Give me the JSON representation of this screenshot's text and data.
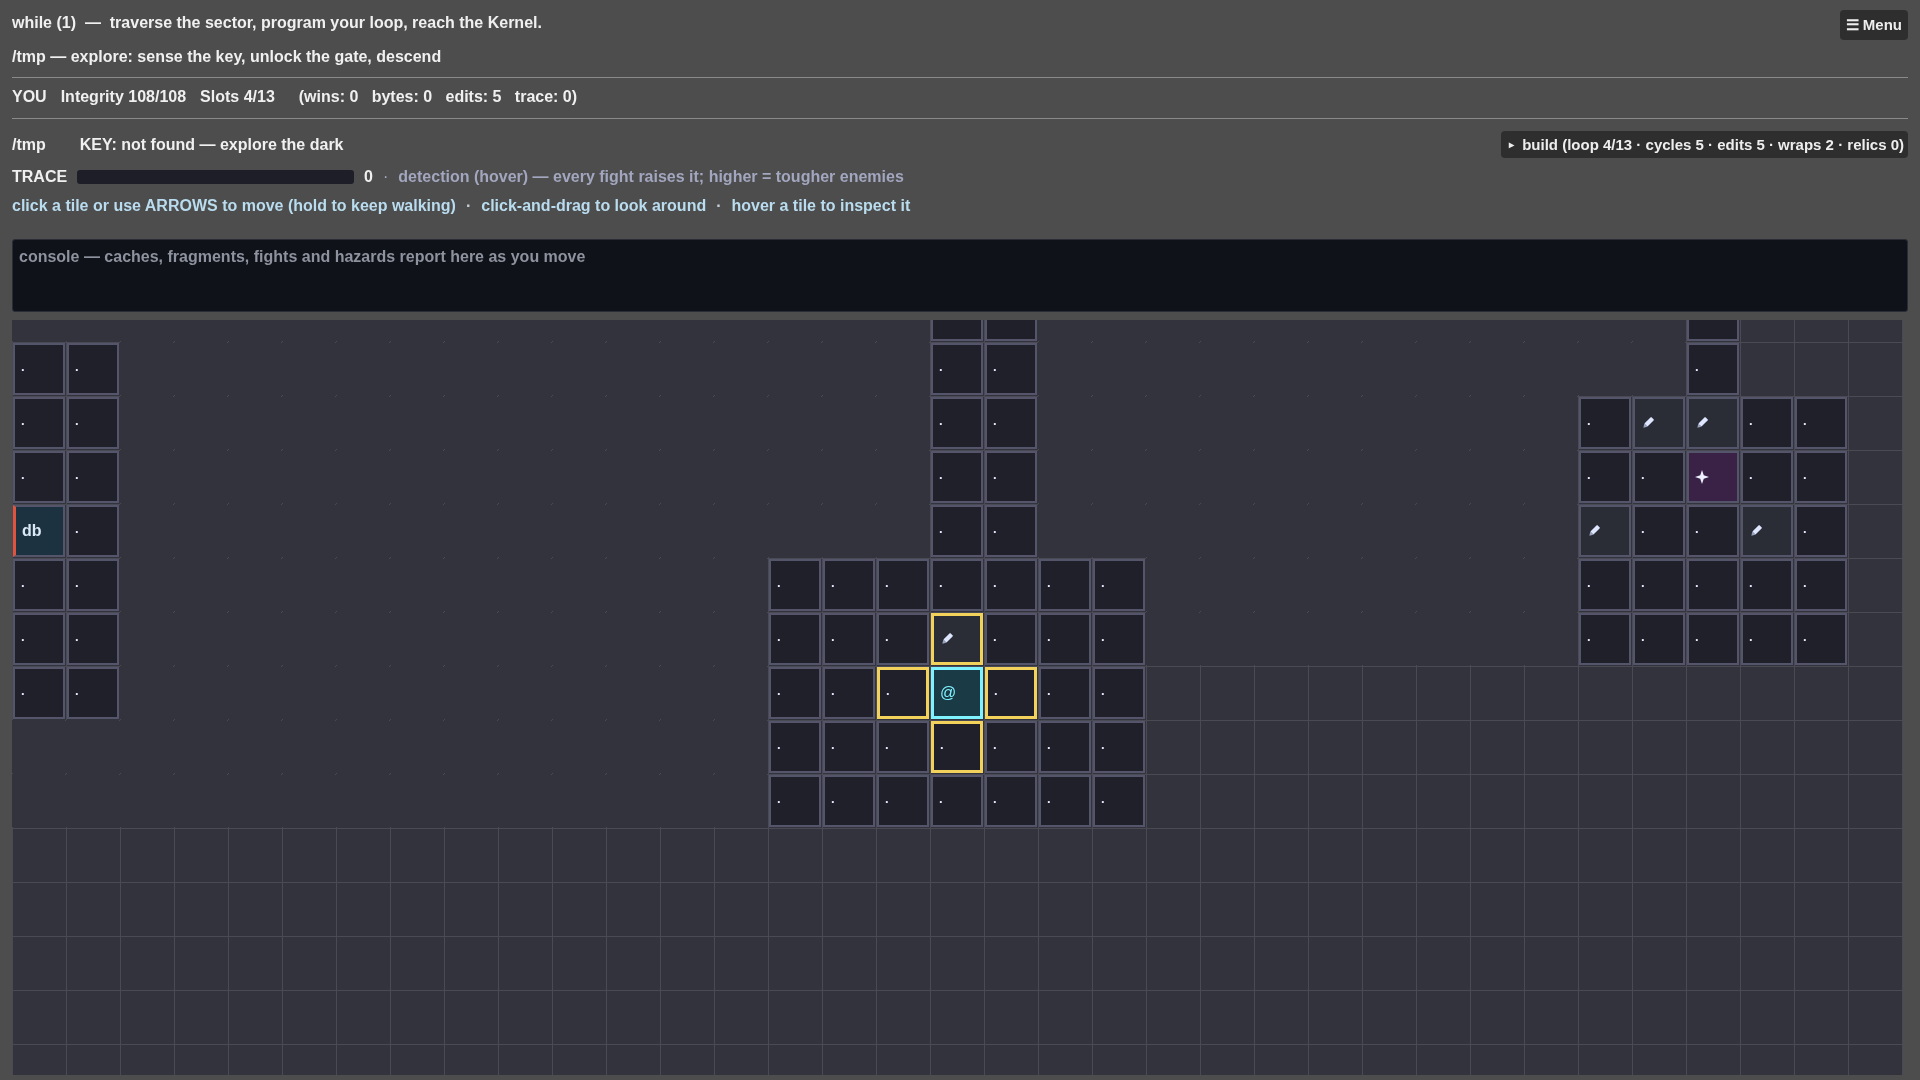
{
  "title": "while (1)  —  traverse the sector, program your loop, reach the Kernel.",
  "menu_button": "☰ Menu",
  "subtitle": "/tmp — explore: sense the key, unlock the gate, descend",
  "status": {
    "you": "YOU",
    "integrity": "Integrity 108/108",
    "slots": "Slots 4/13",
    "counters": "(wins: 0   bytes: 0   edits: 5   trace: 0)"
  },
  "location": {
    "path": "/tmp",
    "key": "KEY: not found — explore the dark"
  },
  "build": {
    "marker": "▸",
    "label": "build (loop 4/13 · cycles 5 · edits 5 · wraps 2 · relics 0)"
  },
  "trace": {
    "label": "TRACE",
    "level": 0,
    "reading": "0",
    "separator": "·",
    "note": "detection (hover) — every fight raises it; higher = tougher enemies"
  },
  "help": [
    {
      "kind": "hint",
      "text": "click a tile or use ARROWS to move (hold to keep walking)"
    },
    {
      "kind": "sep",
      "text": "·"
    },
    {
      "kind": "hint",
      "text": "click-and-drag to look around"
    },
    {
      "kind": "sep",
      "text": "·"
    },
    {
      "kind": "hint",
      "text": "hover a tile to inspect it"
    }
  ],
  "console": {
    "text": "console — caches, fragments, fights and hazards report here as you move"
  },
  "map": {
    "rows": [
      [
        {
          "kind": "fog",
          "reachable": false
        },
        {
          "kind": "fog",
          "reachable": false
        },
        {
          "kind": "fog",
          "reachable": false
        },
        {
          "kind": "fog",
          "reachable": false
        },
        {
          "kind": "fog",
          "reachable": false
        },
        {
          "kind": "fog",
          "reachable": false
        },
        {
          "kind": "fog",
          "reachable": false
        },
        {
          "kind": "fog",
          "reachable": false
        },
        {
          "kind": "fog",
          "reachable": false
        },
        {
          "kind": "fog",
          "reachable": false
        },
        {
          "kind": "fog",
          "reachable": false
        },
        {
          "kind": "fog",
          "reachable": false
        },
        {
          "kind": "fog",
          "reachable": false
        },
        {
          "kind": "fog",
          "reachable": false
        },
        {
          "kind": "fog",
          "reachable": false
        },
        {
          "kind": "fog",
          "reachable": false
        },
        {
          "kind": "fog",
          "reachable": false
        },
        {
          "kind": "floor",
          "reachable": false
        },
        {
          "kind": "floor",
          "reachable": false
        },
        {
          "kind": "fog",
          "reachable": false
        },
        {
          "kind": "fog",
          "reachable": false
        },
        {
          "kind": "fog",
          "reachable": false
        },
        {
          "kind": "fog",
          "reachable": false
        },
        {
          "kind": "fog",
          "reachable": false
        },
        {
          "kind": "fog",
          "reachable": false
        },
        {
          "kind": "fog",
          "reachable": false
        },
        {
          "kind": "fog",
          "reachable": false
        },
        {
          "kind": "fog",
          "reachable": false
        },
        {
          "kind": "fog",
          "reachable": false
        },
        {
          "kind": "fog",
          "reachable": false
        },
        {
          "kind": "fog",
          "reachable": false
        },
        {
          "kind": "floor",
          "reachable": false
        }
      ],
      [
        {
          "kind": "floor",
          "text": "·",
          "reachable": false
        },
        {
          "kind": "floor",
          "text": "·",
          "reachable": false
        },
        {
          "kind": "fog",
          "reachable": false
        },
        {
          "kind": "fog",
          "reachable": false
        },
        {
          "kind": "fog",
          "reachable": false
        },
        {
          "kind": "fog",
          "reachable": false
        },
        {
          "kind": "fog",
          "reachable": false
        },
        {
          "kind": "fog",
          "reachable": false
        },
        {
          "kind": "fog",
          "reachable": false
        },
        {
          "kind": "fog",
          "reachable": false
        },
        {
          "kind": "fog",
          "reachable": false
        },
        {
          "kind": "fog",
          "reachable": false
        },
        {
          "kind": "fog",
          "reachable": false
        },
        {
          "kind": "fog",
          "reachable": false
        },
        {
          "kind": "fog",
          "reachable": false
        },
        {
          "kind": "fog",
          "reachable": false
        },
        {
          "kind": "fog",
          "reachable": false
        },
        {
          "kind": "floor",
          "text": "·",
          "reachable": false
        },
        {
          "kind": "floor",
          "text": "·",
          "reachable": false
        },
        {
          "kind": "fog",
          "reachable": false
        },
        {
          "kind": "fog",
          "reachable": false
        },
        {
          "kind": "fog",
          "reachable": false
        },
        {
          "kind": "fog",
          "reachable": false
        },
        {
          "kind": "fog",
          "reachable": false
        },
        {
          "kind": "fog",
          "reachable": false
        },
        {
          "kind": "fog",
          "reachable": false
        },
        {
          "kind": "fog",
          "reachable": false
        },
        {
          "kind": "fog",
          "reachable": false
        },
        {
          "kind": "fog",
          "reachable": false
        },
        {
          "kind": "fog",
          "reachable": false
        },
        {
          "kind": "fog",
          "reachable": false
        },
        {
          "kind": "floor",
          "text": "·",
          "reachable": false
        }
      ],
      [
        {
          "kind": "floor",
          "text": "·",
          "reachable": false
        },
        {
          "kind": "floor",
          "text": "·",
          "reachable": false
        },
        {
          "kind": "fog",
          "reachable": false
        },
        {
          "kind": "fog",
          "reachable": false
        },
        {
          "kind": "fog",
          "reachable": false
        },
        {
          "kind": "fog",
          "reachable": false
        },
        {
          "kind": "fog",
          "reachable": false
        },
        {
          "kind": "fog",
          "reachable": false
        },
        {
          "kind": "fog",
          "reachable": false
        },
        {
          "kind": "fog",
          "reachable": false
        },
        {
          "kind": "fog",
          "reachable": false
        },
        {
          "kind": "fog",
          "reachable": false
        },
        {
          "kind": "fog",
          "reachable": false
        },
        {
          "kind": "fog",
          "reachable": false
        },
        {
          "kind": "fog",
          "reachable": false
        },
        {
          "kind": "fog",
          "reachable": false
        },
        {
          "kind": "fog",
          "reachable": false
        },
        {
          "kind": "floor",
          "text": "·",
          "reachable": false
        },
        {
          "kind": "floor",
          "text": "·",
          "reachable": false
        },
        {
          "kind": "fog",
          "reachable": false
        },
        {
          "kind": "fog",
          "reachable": false
        },
        {
          "kind": "fog",
          "reachable": false
        },
        {
          "kind": "fog",
          "reachable": false
        },
        {
          "kind": "fog",
          "reachable": false
        },
        {
          "kind": "fog",
          "reachable": false
        },
        {
          "kind": "fog",
          "reachable": false
        },
        {
          "kind": "fog",
          "reachable": false
        },
        {
          "kind": "fog",
          "reachable": false
        },
        {
          "kind": "fog",
          "reachable": false
        },
        {
          "kind": "floor",
          "text": "·",
          "reachable": false
        },
        {
          "kind": "edit",
          "reachable": false
        },
        {
          "kind": "edit",
          "reachable": false
        },
        {
          "kind": "floor",
          "text": "·",
          "reachable": false
        },
        {
          "kind": "floor",
          "text": "·",
          "reachable": false
        }
      ],
      [
        {
          "kind": "floor",
          "text": "·",
          "reachable": false
        },
        {
          "kind": "floor",
          "text": "·",
          "reachable": false
        },
        {
          "kind": "fog",
          "reachable": false
        },
        {
          "kind": "fog",
          "reachable": false
        },
        {
          "kind": "fog",
          "reachable": false
        },
        {
          "kind": "fog",
          "reachable": false
        },
        {
          "kind": "fog",
          "reachable": false
        },
        {
          "kind": "fog",
          "reachable": false
        },
        {
          "kind": "fog",
          "reachable": false
        },
        {
          "kind": "fog",
          "reachable": false
        },
        {
          "kind": "fog",
          "reachable": false
        },
        {
          "kind": "fog",
          "reachable": false
        },
        {
          "kind": "fog",
          "reachable": false
        },
        {
          "kind": "fog",
          "reachable": false
        },
        {
          "kind": "fog",
          "reachable": false
        },
        {
          "kind": "fog",
          "reachable": false
        },
        {
          "kind": "fog",
          "reachable": false
        },
        {
          "kind": "floor",
          "text": "·",
          "reachable": false
        },
        {
          "kind": "floor",
          "text": "·",
          "reachable": false
        },
        {
          "kind": "fog",
          "reachable": false
        },
        {
          "kind": "fog",
          "reachable": false
        },
        {
          "kind": "fog",
          "reachable": false
        },
        {
          "kind": "fog",
          "reachable": false
        },
        {
          "kind": "fog",
          "reachable": false
        },
        {
          "kind": "fog",
          "reachable": false
        },
        {
          "kind": "fog",
          "reachable": false
        },
        {
          "kind": "fog",
          "reachable": false
        },
        {
          "kind": "fog",
          "reachable": false
        },
        {
          "kind": "fog",
          "reachable": false
        },
        {
          "kind": "floor",
          "text": "·",
          "reachable": false
        },
        {
          "kind": "floor",
          "text": "·",
          "reachable": false
        },
        {
          "kind": "relic",
          "reachable": false
        },
        {
          "kind": "floor",
          "text": "·",
          "reachable": false
        },
        {
          "kind": "floor",
          "text": "·",
          "reachable": false
        }
      ],
      [
        {
          "kind": "db",
          "text": "db",
          "reachable": false
        },
        {
          "kind": "floor",
          "text": "·",
          "reachable": false
        },
        {
          "kind": "fog",
          "reachable": false
        },
        {
          "kind": "fog",
          "reachable": false
        },
        {
          "kind": "fog",
          "reachable": false
        },
        {
          "kind": "fog",
          "reachable": false
        },
        {
          "kind": "fog",
          "reachable": false
        },
        {
          "kind": "fog",
          "reachable": false
        },
        {
          "kind": "fog",
          "reachable": false
        },
        {
          "kind": "fog",
          "reachable": false
        },
        {
          "kind": "fog",
          "reachable": false
        },
        {
          "kind": "fog",
          "reachable": false
        },
        {
          "kind": "fog",
          "reachable": false
        },
        {
          "kind": "fog",
          "reachable": false
        },
        {
          "kind": "fog",
          "reachable": false
        },
        {
          "kind": "fog",
          "reachable": false
        },
        {
          "kind": "fog",
          "reachable": false
        },
        {
          "kind": "floor",
          "text": "·",
          "reachable": false
        },
        {
          "kind": "floor",
          "text": "·",
          "reachable": false
        },
        {
          "kind": "fog",
          "reachable": false
        },
        {
          "kind": "fog",
          "reachable": false
        },
        {
          "kind": "fog",
          "reachable": false
        },
        {
          "kind": "fog",
          "reachable": false
        },
        {
          "kind": "fog",
          "reachable": false
        },
        {
          "kind": "fog",
          "reachable": false
        },
        {
          "kind": "fog",
          "reachable": false
        },
        {
          "kind": "fog",
          "reachable": false
        },
        {
          "kind": "fog",
          "reachable": false
        },
        {
          "kind": "fog",
          "reachable": false
        },
        {
          "kind": "edit",
          "reachable": false
        },
        {
          "kind": "floor",
          "text": "·",
          "reachable": false
        },
        {
          "kind": "floor",
          "text": "·",
          "reachable": false
        },
        {
          "kind": "edit",
          "reachable": false
        },
        {
          "kind": "floor",
          "text": "·",
          "reachable": false
        }
      ],
      [
        {
          "kind": "floor",
          "text": "·",
          "reachable": false
        },
        {
          "kind": "floor",
          "text": "·",
          "reachable": false
        },
        {
          "kind": "fog",
          "reachable": false
        },
        {
          "kind": "fog",
          "reachable": false
        },
        {
          "kind": "fog",
          "reachable": false
        },
        {
          "kind": "fog",
          "reachable": false
        },
        {
          "kind": "fog",
          "reachable": false
        },
        {
          "kind": "fog",
          "reachable": false
        },
        {
          "kind": "fog",
          "reachable": false
        },
        {
          "kind": "fog",
          "reachable": false
        },
        {
          "kind": "fog",
          "reachable": false
        },
        {
          "kind": "fog",
          "reachable": false
        },
        {
          "kind": "fog",
          "reachable": false
        },
        {
          "kind": "fog",
          "reachable": false
        },
        {
          "kind": "floor",
          "text": "·",
          "reachable": false
        },
        {
          "kind": "floor",
          "text": "·",
          "reachable": false
        },
        {
          "kind": "floor",
          "text": "·",
          "reachable": false
        },
        {
          "kind": "floor",
          "text": "·",
          "reachable": false
        },
        {
          "kind": "floor",
          "text": "·",
          "reachable": false
        },
        {
          "kind": "floor",
          "text": "·",
          "reachable": false
        },
        {
          "kind": "floor",
          "text": "·",
          "reachable": false
        },
        {
          "kind": "fog",
          "reachable": false
        },
        {
          "kind": "fog",
          "reachable": false
        },
        {
          "kind": "fog",
          "reachable": false
        },
        {
          "kind": "fog",
          "reachable": false
        },
        {
          "kind": "fog",
          "reachable": false
        },
        {
          "kind": "fog",
          "reachable": false
        },
        {
          "kind": "fog",
          "reachable": false
        },
        {
          "kind": "fog",
          "reachable": false
        },
        {
          "kind": "floor",
          "text": "·",
          "reachable": false
        },
        {
          "kind": "floor",
          "text": "·",
          "reachable": false
        },
        {
          "kind": "floor",
          "text": "·",
          "reachable": false
        },
        {
          "kind": "floor",
          "text": "·",
          "reachable": false
        },
        {
          "kind": "floor",
          "text": "·",
          "reachable": false
        }
      ],
      [
        {
          "kind": "floor",
          "text": "·",
          "reachable": false
        },
        {
          "kind": "floor",
          "text": "·",
          "reachable": false
        },
        {
          "kind": "fog",
          "reachable": false
        },
        {
          "kind": "fog",
          "reachable": false
        },
        {
          "kind": "fog",
          "reachable": false
        },
        {
          "kind": "fog",
          "reachable": false
        },
        {
          "kind": "fog",
          "reachable": false
        },
        {
          "kind": "fog",
          "reachable": false
        },
        {
          "kind": "fog",
          "reachable": false
        },
        {
          "kind": "fog",
          "reachable": false
        },
        {
          "kind": "fog",
          "reachable": false
        },
        {
          "kind": "fog",
          "reachable": false
        },
        {
          "kind": "fog",
          "reachable": false
        },
        {
          "kind": "fog",
          "reachable": false
        },
        {
          "kind": "floor",
          "text": "·",
          "reachable": false
        },
        {
          "kind": "floor",
          "text": "·",
          "reachable": false
        },
        {
          "kind": "floor",
          "text": "·",
          "reachable": false
        },
        {
          "kind": "edit",
          "reachable": true
        },
        {
          "kind": "floor",
          "text": "·",
          "reachable": false
        },
        {
          "kind": "floor",
          "text": "·",
          "reachable": false
        },
        {
          "kind": "floor",
          "text": "·",
          "reachable": false
        },
        {
          "kind": "fog",
          "reachable": false
        },
        {
          "kind": "fog",
          "reachable": false
        },
        {
          "kind": "fog",
          "reachable": false
        },
        {
          "kind": "fog",
          "reachable": false
        },
        {
          "kind": "fog",
          "reachable": false
        },
        {
          "kind": "fog",
          "reachable": false
        },
        {
          "kind": "fog",
          "reachable": false
        },
        {
          "kind": "fog",
          "reachable": false
        },
        {
          "kind": "floor",
          "text": "·",
          "reachable": false
        },
        {
          "kind": "floor",
          "text": "·",
          "reachable": false
        },
        {
          "kind": "floor",
          "text": "·",
          "reachable": false
        },
        {
          "kind": "floor",
          "text": "·",
          "reachable": false
        },
        {
          "kind": "floor",
          "text": "·",
          "reachable": false
        }
      ],
      [
        {
          "kind": "floor",
          "text": "·",
          "reachable": false
        },
        {
          "kind": "floor",
          "text": "·",
          "reachable": false
        },
        {
          "kind": "fog",
          "reachable": false
        },
        {
          "kind": "fog",
          "reachable": false
        },
        {
          "kind": "fog",
          "reachable": false
        },
        {
          "kind": "fog",
          "reachable": false
        },
        {
          "kind": "fog",
          "reachable": false
        },
        {
          "kind": "fog",
          "reachable": false
        },
        {
          "kind": "fog",
          "reachable": false
        },
        {
          "kind": "fog",
          "reachable": false
        },
        {
          "kind": "fog",
          "reachable": false
        },
        {
          "kind": "fog",
          "reachable": false
        },
        {
          "kind": "fog",
          "reachable": false
        },
        {
          "kind": "fog",
          "reachable": false
        },
        {
          "kind": "floor",
          "text": "·",
          "reachable": false
        },
        {
          "kind": "floor",
          "text": "·",
          "reachable": false
        },
        {
          "kind": "floor",
          "text": "·",
          "reachable": true
        },
        {
          "kind": "player",
          "text": "@",
          "reachable": false
        },
        {
          "kind": "floor",
          "text": "·",
          "reachable": true
        },
        {
          "kind": "floor",
          "text": "·",
          "reachable": false
        },
        {
          "kind": "floor",
          "text": "·",
          "reachable": false
        }
      ],
      [
        {
          "kind": "fog",
          "reachable": false
        },
        {
          "kind": "fog",
          "reachable": false
        },
        {
          "kind": "fog",
          "reachable": false
        },
        {
          "kind": "fog",
          "reachable": false
        },
        {
          "kind": "fog",
          "reachable": false
        },
        {
          "kind": "fog",
          "reachable": false
        },
        {
          "kind": "fog",
          "reachable": false
        },
        {
          "kind": "fog",
          "reachable": false
        },
        {
          "kind": "fog",
          "reachable": false
        },
        {
          "kind": "fog",
          "reachable": false
        },
        {
          "kind": "fog",
          "reachable": false
        },
        {
          "kind": "fog",
          "reachable": false
        },
        {
          "kind": "fog",
          "reachable": false
        },
        {
          "kind": "fog",
          "reachable": false
        },
        {
          "kind": "floor",
          "text": "·",
          "reachable": false
        },
        {
          "kind": "floor",
          "text": "·",
          "reachable": false
        },
        {
          "kind": "floor",
          "text": "·",
          "reachable": false
        },
        {
          "kind": "floor",
          "text": "·",
          "reachable": true
        },
        {
          "kind": "floor",
          "text": "·",
          "reachable": false
        },
        {
          "kind": "floor",
          "text": "·",
          "reachable": false
        },
        {
          "kind": "floor",
          "text": "·",
          "reachable": false
        }
      ],
      [
        {
          "kind": "fog",
          "reachable": false
        },
        {
          "kind": "fog",
          "reachable": false
        },
        {
          "kind": "fog",
          "reachable": false
        },
        {
          "kind": "fog",
          "reachable": false
        },
        {
          "kind": "fog",
          "reachable": false
        },
        {
          "kind": "fog",
          "reachable": false
        },
        {
          "kind": "fog",
          "reachable": false
        },
        {
          "kind": "fog",
          "reachable": false
        },
        {
          "kind": "fog",
          "reachable": false
        },
        {
          "kind": "fog",
          "reachable": false
        },
        {
          "kind": "fog",
          "reachable": false
        },
        {
          "kind": "fog",
          "reachable": false
        },
        {
          "kind": "fog",
          "reachable": false
        },
        {
          "kind": "fog",
          "reachable": false
        },
        {
          "kind": "floor",
          "text": "·",
          "reachable": false
        },
        {
          "kind": "floor",
          "text": "·",
          "reachable": false
        },
        {
          "kind": "floor",
          "text": "·",
          "reachable": false
        },
        {
          "kind": "floor",
          "text": "·",
          "reachable": false
        },
        {
          "kind": "floor",
          "text": "·",
          "reachable": false
        },
        {
          "kind": "floor",
          "text": "·",
          "reachable": false
        },
        {
          "kind": "floor",
          "text": "·",
          "reachable": false
        }
      ]
    ]
  }
}
